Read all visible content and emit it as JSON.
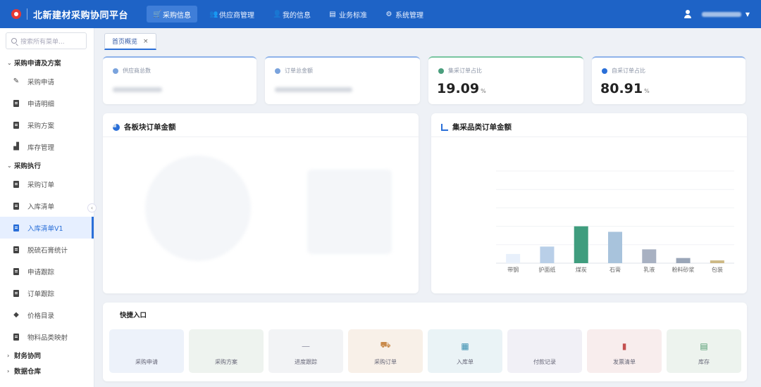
{
  "app": {
    "title": "北新建材采购协同平台"
  },
  "colors": {
    "primary": "#1e63c6",
    "accent_green": "#4a9e7d",
    "active_bg": "#e6efff"
  },
  "top_nav": [
    {
      "label": "采购信息",
      "icon": "cart-icon",
      "active": true
    },
    {
      "label": "供应商管理",
      "icon": "users-icon",
      "active": false
    },
    {
      "label": "我的信息",
      "icon": "person-icon",
      "active": false
    },
    {
      "label": "业务标准",
      "icon": "book-icon",
      "active": false
    },
    {
      "label": "系统管理",
      "icon": "gear-icon",
      "active": false
    }
  ],
  "sidebar": {
    "search_placeholder": "搜索所有菜单...",
    "groups": [
      {
        "label": "采购申请及方案",
        "expanded": true,
        "items": [
          {
            "label": "采购申请",
            "icon": "edit-doc-icon"
          },
          {
            "label": "申请明细",
            "icon": "doc-icon"
          },
          {
            "label": "采购方案",
            "icon": "clipboard-icon"
          },
          {
            "label": "库存管理",
            "icon": "boxes-icon"
          }
        ]
      },
      {
        "label": "采购执行",
        "expanded": true,
        "items": [
          {
            "label": "采购订单",
            "icon": "doc-icon"
          },
          {
            "label": "入库清单",
            "icon": "doc-icon"
          },
          {
            "label": "入库清单V1",
            "icon": "doc-icon",
            "active": true
          },
          {
            "label": "脱硫石膏统计",
            "icon": "doc-icon"
          },
          {
            "label": "申请跟踪",
            "icon": "doc-icon"
          },
          {
            "label": "订单跟踪",
            "icon": "doc-icon"
          },
          {
            "label": "价格目录",
            "icon": "tag-icon"
          },
          {
            "label": "物料品类映射",
            "icon": "doc-icon"
          }
        ]
      },
      {
        "label": "财务协同",
        "expanded": false
      },
      {
        "label": "数据仓库",
        "expanded": false
      }
    ]
  },
  "tabs": [
    {
      "label": "首页概览",
      "closable": true
    }
  ],
  "stats": [
    {
      "label": "供应商总数",
      "value": "",
      "icon": "users-icon"
    },
    {
      "label": "订单总金额",
      "value": "",
      "icon": "coin-icon"
    },
    {
      "label": "集采订单占比",
      "value": "19.09",
      "unit": "%",
      "icon": "check-circle-icon"
    },
    {
      "label": "自采订单占比",
      "value": "80.91",
      "unit": "%",
      "icon": "cube-icon"
    }
  ],
  "panels": {
    "left_title": "各板块订单金额",
    "right_title": "集采品类订单金额"
  },
  "chart_data": {
    "type": "bar",
    "title": "集采品类订单金额",
    "categories": [
      "带钢",
      "护面纸",
      "煤炭",
      "石膏",
      "乳液",
      "粉料砂浆",
      "包装"
    ],
    "values": [
      5,
      9,
      20,
      17,
      7.5,
      2.8,
      1.5
    ],
    "colors": [
      "#e8f0fb",
      "#b9cfe8",
      "#3f9d7e",
      "#a8c3dc",
      "#a8b1c2",
      "#9aa6b8",
      "#cdb985"
    ],
    "ylim": [
      0,
      50
    ],
    "grid": true
  },
  "quick": {
    "title": "快捷入口",
    "tiles": [
      {
        "label": "采购申请",
        "icon": "",
        "bg": "#edf2fa",
        "color": "#667"
      },
      {
        "label": "采购方案",
        "icon": "",
        "bg": "#eef3ef",
        "color": "#667"
      },
      {
        "label": "进度跟踪",
        "icon": "—",
        "bg": "#f2f3f5",
        "color": "#99a"
      },
      {
        "label": "采购订单",
        "icon": "⛟",
        "bg": "#f8f0e8",
        "color": "#c98a4a"
      },
      {
        "label": "入库单",
        "icon": "▦",
        "bg": "#eaf3f6",
        "color": "#3a8fb0"
      },
      {
        "label": "付款记录",
        "icon": "",
        "bg": "#f1f0f6",
        "color": "#667"
      },
      {
        "label": "发票清单",
        "icon": "▮",
        "bg": "#f8eded",
        "color": "#c45050"
      },
      {
        "label": "库存",
        "icon": "▤",
        "bg": "#edf3ee",
        "color": "#4e9a6e"
      }
    ]
  }
}
